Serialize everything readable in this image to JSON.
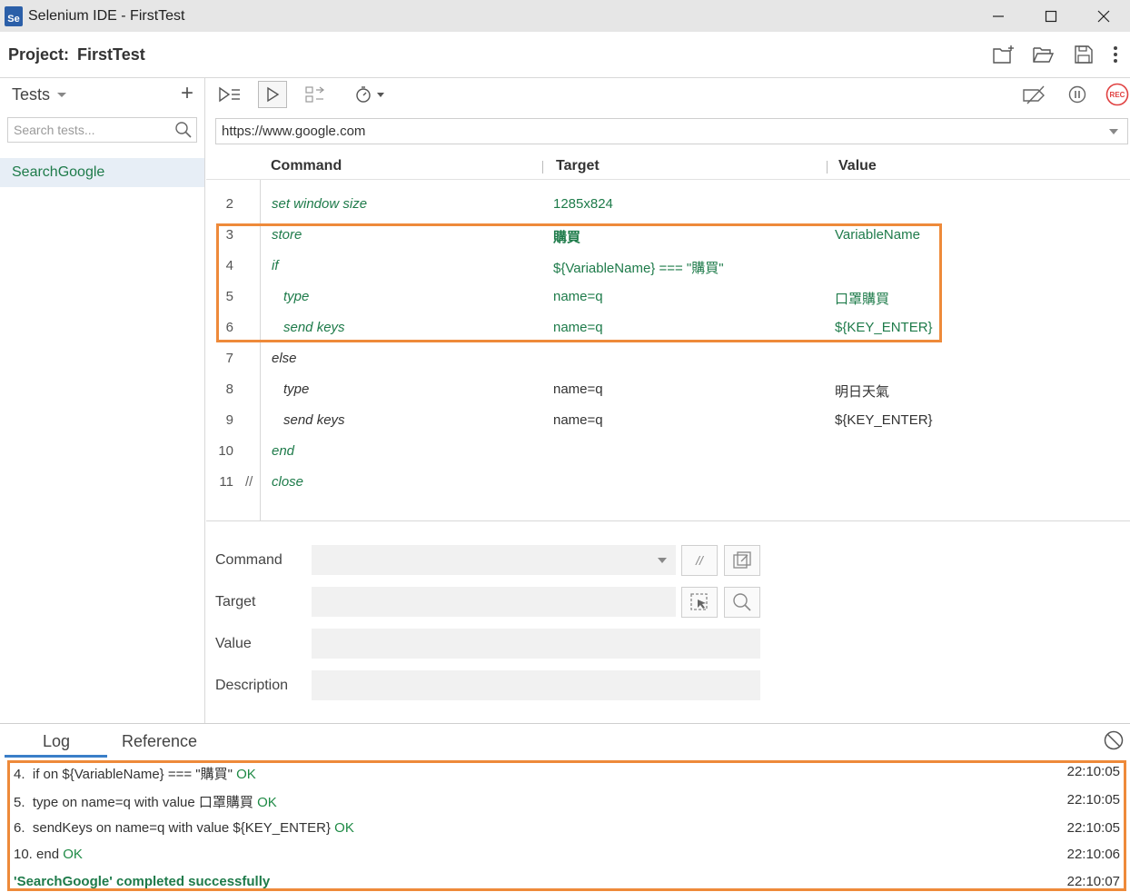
{
  "window": {
    "logo_text": "Se",
    "title": "Selenium IDE - FirstTest"
  },
  "project": {
    "label": "Project:",
    "name": "FirstTest"
  },
  "sidebar": {
    "title": "Tests",
    "search_placeholder": "Search tests...",
    "tests": [
      {
        "name": "SearchGoogle"
      }
    ]
  },
  "toolbar": {
    "rec_label": "REC"
  },
  "url": "https://www.google.com",
  "table": {
    "headers": {
      "command": "Command",
      "target": "Target",
      "value": "Value"
    },
    "rows": [
      {
        "num": "2",
        "comment": "",
        "command": "set window size",
        "target": "1285x824",
        "value": ""
      },
      {
        "num": "3",
        "comment": "",
        "command": "store",
        "target": "購買",
        "value": "VariableName"
      },
      {
        "num": "4",
        "comment": "",
        "command": "if",
        "target": "${VariableName} === \"購買\"",
        "value": ""
      },
      {
        "num": "5",
        "comment": "",
        "command": "type",
        "target": "name=q",
        "value": "口罩購買"
      },
      {
        "num": "6",
        "comment": "",
        "command": "send keys",
        "target": "name=q",
        "value": "${KEY_ENTER}"
      },
      {
        "num": "7",
        "comment": "",
        "command": "else",
        "target": "",
        "value": ""
      },
      {
        "num": "8",
        "comment": "",
        "command": "type",
        "target": "name=q",
        "value": "明日天氣"
      },
      {
        "num": "9",
        "comment": "",
        "command": "send keys",
        "target": "name=q",
        "value": "${KEY_ENTER}"
      },
      {
        "num": "10",
        "comment": "",
        "command": "end",
        "target": "",
        "value": ""
      },
      {
        "num": "11",
        "comment": "//",
        "command": "close",
        "target": "",
        "value": ""
      }
    ]
  },
  "editor": {
    "command_label": "Command",
    "target_label": "Target",
    "value_label": "Value",
    "description_label": "Description",
    "comment_button": "//"
  },
  "log": {
    "tabs": [
      "Log",
      "Reference"
    ],
    "lines": [
      {
        "prefix": "4.",
        "text": "if on ${VariableName} === \"購買\"",
        "status": "OK",
        "time": "22:10:05"
      },
      {
        "prefix": "5.",
        "text": "type on name=q with value 口罩購買",
        "status": "OK",
        "time": "22:10:05"
      },
      {
        "prefix": "6.",
        "text": "sendKeys on name=q with value ${KEY_ENTER}",
        "status": "OK",
        "time": "22:10:05"
      },
      {
        "prefix": "10.",
        "text": "end",
        "status": "OK",
        "time": "22:10:06"
      }
    ],
    "summary": {
      "text": "'SearchGoogle' completed successfully",
      "time": "22:10:07"
    }
  },
  "colors": {
    "accent_green": "#1e7b4a",
    "highlight_orange": "#ee8a3a",
    "record_red": "#e04040",
    "tab_blue": "#3a7ec8"
  }
}
